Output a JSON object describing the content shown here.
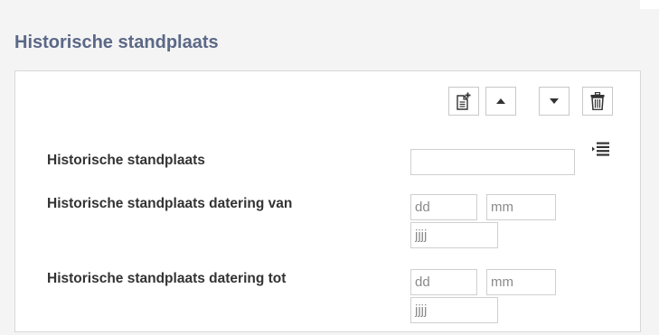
{
  "section": {
    "title": "Historische standplaats"
  },
  "toolbar": {
    "add_icon": "add-document-icon",
    "up_icon": "caret-up-icon",
    "down_icon": "caret-down-icon",
    "delete_icon": "trash-icon"
  },
  "fields": {
    "standplaats": {
      "label": "Historische standplaats",
      "value": "",
      "list_icon": "bullet-list-icon"
    },
    "datering_van": {
      "label": "Historische standplaats datering van",
      "day_placeholder": "dd",
      "month_placeholder": "mm",
      "year_placeholder": "jjjj"
    },
    "datering_tot": {
      "label": "Historische standplaats datering tot",
      "day_placeholder": "dd",
      "month_placeholder": "mm",
      "year_placeholder": "jjjj"
    }
  },
  "colors": {
    "title": "#5b6887",
    "section_background": "#f4f4f4",
    "panel_border": "#d8d8d8",
    "label_text": "#333333"
  }
}
